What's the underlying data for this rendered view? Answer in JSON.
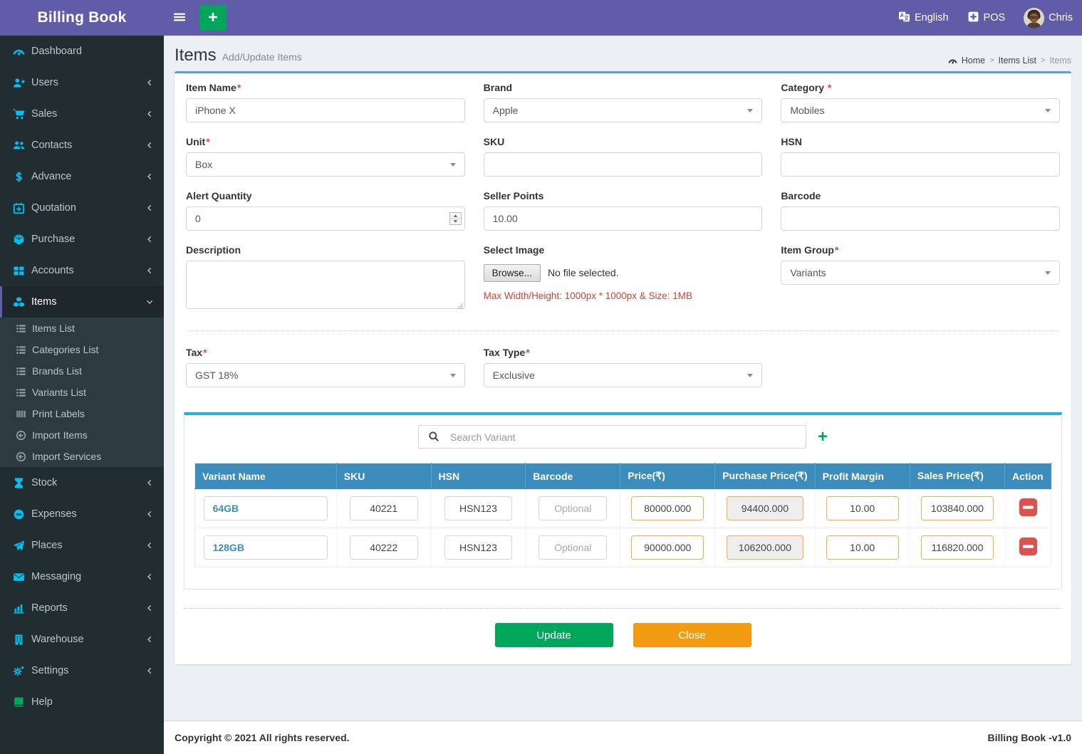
{
  "colors": {
    "accent_purple": "#605ca8",
    "sidebar_dark": "#222d32",
    "icon_cyan": "#00c0ef",
    "table_header_blue": "#3c8dbc",
    "success_green": "#00a65a",
    "warning_orange": "#f39c12",
    "danger_red": "#dd4b39",
    "price_border_orange": "#f0ad4e"
  },
  "required_mark": "*",
  "header": {
    "brand": "Billing Book",
    "language": "English",
    "pos": "POS",
    "user": "Chris"
  },
  "sidebar": {
    "items": [
      {
        "label": "Dashboard",
        "icon": "tachometer"
      },
      {
        "label": "Users",
        "icon": "user-plus",
        "chevron": "left"
      },
      {
        "label": "Sales",
        "icon": "cart",
        "chevron": "left"
      },
      {
        "label": "Contacts",
        "icon": "users",
        "chevron": "left"
      },
      {
        "label": "Advance",
        "icon": "dollar",
        "chevron": "left"
      },
      {
        "label": "Quotation",
        "icon": "calendar-plus",
        "chevron": "left"
      },
      {
        "label": "Purchase",
        "icon": "cube",
        "chevron": "left"
      },
      {
        "label": "Accounts",
        "icon": "th-large",
        "chevron": "left"
      },
      {
        "label": "Items",
        "icon": "cubes",
        "chevron": "down",
        "active": true,
        "submenu": [
          {
            "label": "Items List",
            "icon": "list"
          },
          {
            "label": "Categories List",
            "icon": "list"
          },
          {
            "label": "Brands List",
            "icon": "list"
          },
          {
            "label": "Variants List",
            "icon": "list"
          },
          {
            "label": "Print Labels",
            "icon": "barcode"
          },
          {
            "label": "Import Items",
            "icon": "import"
          },
          {
            "label": "Import Services",
            "icon": "import"
          }
        ]
      },
      {
        "label": "Stock",
        "icon": "hourglass",
        "chevron": "left"
      },
      {
        "label": "Expenses",
        "icon": "minus-circle",
        "chevron": "left"
      },
      {
        "label": "Places",
        "icon": "send",
        "chevron": "left"
      },
      {
        "label": "Messaging",
        "icon": "envelope",
        "chevron": "left"
      },
      {
        "label": "Reports",
        "icon": "bar-chart",
        "chevron": "left"
      },
      {
        "label": "Warehouse",
        "icon": "building",
        "chevron": "left"
      },
      {
        "label": "Settings",
        "icon": "gears",
        "chevron": "left"
      },
      {
        "label": "Help",
        "icon": "book",
        "icon_color": "#00a65a"
      }
    ]
  },
  "page": {
    "title": "Items",
    "subtitle": "Add/Update Items"
  },
  "breadcrumb": {
    "items": [
      "Home",
      "Items List",
      "Items"
    ]
  },
  "form": {
    "item_name": {
      "label": "Item Name",
      "value": "iPhone X"
    },
    "brand": {
      "label": "Brand",
      "value": "Apple"
    },
    "category": {
      "label": "Category ",
      "value": "Mobiles"
    },
    "unit": {
      "label": "Unit",
      "value": "Box"
    },
    "sku": {
      "label": "SKU",
      "value": ""
    },
    "hsn": {
      "label": "HSN",
      "value": ""
    },
    "alert_quantity": {
      "label": "Alert Quantity",
      "value": "0"
    },
    "seller_points": {
      "label": "Seller Points",
      "value": "10.00"
    },
    "barcode": {
      "label": "Barcode",
      "value": ""
    },
    "description": {
      "label": "Description",
      "value": ""
    },
    "select_image": {
      "label": "Select Image",
      "browse": "Browse...",
      "status": "No file selected.",
      "note": "Max Width/Height: 1000px * 1000px & Size: 1MB"
    },
    "item_group": {
      "label": "Item Group",
      "value": "Variants"
    },
    "tax": {
      "label": "Tax",
      "value": "GST 18%"
    },
    "tax_type": {
      "label": "Tax Type",
      "value": "Exclusive"
    }
  },
  "variants": {
    "search_placeholder": "Search Variant",
    "add_button": "+",
    "columns": [
      "Variant Name",
      "SKU",
      "HSN",
      "Barcode",
      "Price(₹)",
      "Purchase Price(₹)",
      "Profit Margin",
      "Sales Price(₹)",
      "Action"
    ],
    "rows": [
      {
        "name": "64GB",
        "sku": "40221",
        "hsn": "HSN123",
        "barcode": "",
        "barcode_placeholder": "Optional",
        "price": "80000.000",
        "purchase_price": "94400.000",
        "profit_margin": "10.00",
        "sales_price": "103840.000"
      },
      {
        "name": "128GB",
        "sku": "40222",
        "hsn": "HSN123",
        "barcode": "",
        "barcode_placeholder": "Optional",
        "price": "90000.000",
        "purchase_price": "106200.000",
        "profit_margin": "10.00",
        "sales_price": "116820.000"
      }
    ]
  },
  "actions": {
    "update": "Update",
    "close": "Close"
  },
  "footer": {
    "copyright": "Copyright © 2021 All rights reserved.",
    "version": "Billing Book -v1.0"
  }
}
